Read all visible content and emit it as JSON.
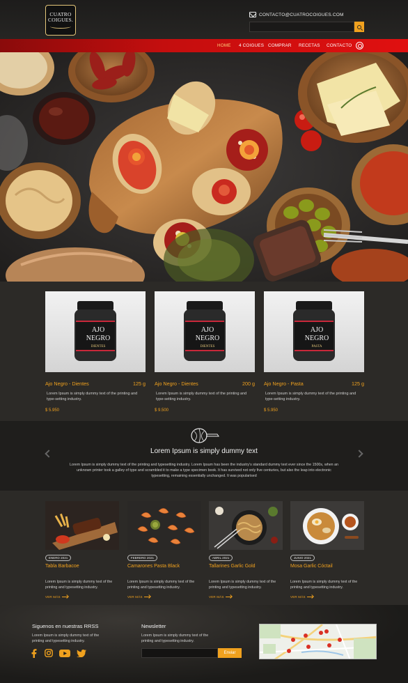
{
  "header": {
    "logo": {
      "line1": "CUATRO",
      "line2": "COIGUES."
    },
    "email": "CONTACTO@CUATROCOIGUES.COM",
    "search": {
      "placeholder": ""
    }
  },
  "nav": {
    "items": [
      {
        "label": "HOME",
        "active": true
      },
      {
        "label": "4 COIGUES"
      },
      {
        "label": "COMPRAR"
      },
      {
        "label": "RECETAS"
      },
      {
        "label": "CONTACTO"
      }
    ]
  },
  "products": [
    {
      "name": "Ajo Negro - Dientes",
      "weight": "125 g",
      "desc": "Lorem Ipsum is simply dummy text of the printing and type-setting industry.",
      "price": "$ 5.950",
      "jar": {
        "l1": "AJO",
        "l2": "NEGRO",
        "l3": "DIENTES"
      }
    },
    {
      "name": "Ajo Negro - Dientes",
      "weight": "200 g",
      "desc": "Lorem Ipsum is simply dummy text of the printing and type-setting industry.",
      "price": "$ 9.500",
      "jar": {
        "l1": "AJO",
        "l2": "NEGRO",
        "l3": "DIENTES"
      }
    },
    {
      "name": "Ajo Negro - Pasta",
      "weight": "125 g",
      "desc": "Lorem Ipsum is simply dummy text of the printing and type-setting industry.",
      "price": "$ 5.950",
      "jar": {
        "l1": "AJO",
        "l2": "NEGRO",
        "l3": "PASTA"
      }
    }
  ],
  "band": {
    "title": "Lorem Ipsum is simply dummy text",
    "text": "Lorem Ipsum is simply dummy text of the printing and typesetting industry. Lorem Ipsum has been the industry's standard dummy text ever since the 1500s, when an unknown printer took a galley of type and scrambled it to make a type specimen book. It has survived not only five centuries, but also the leap into electronic typesetting, remaining essentially unchanged. It was popularised"
  },
  "recipes": [
    {
      "date": "ENERO 2021",
      "title": "Tabla Barbacoe",
      "desc": "Lorem Ipsum is simply dummy text of the printing and typesetting industry.",
      "more": "VER MÁS"
    },
    {
      "date": "FEBRERO 2021",
      "title": "Camarones Pasta Black",
      "desc": "Lorem Ipsum is simply dummy text of the printing and typesetting industry.",
      "more": "VER MÁS"
    },
    {
      "date": "ABRIL 2021",
      "title": "Tallarines Garlic Gold",
      "desc": "Lorem Ipsum is simply dummy text of the printing and typesetting industry.",
      "more": "VER MÁS"
    },
    {
      "date": "JUNIO 2021",
      "title": "Mosa Garlic Cóctail",
      "desc": "Lorem Ipsum is simply dummy text of the printing and typesetting industry.",
      "more": "VER MÁS"
    }
  ],
  "footer": {
    "social_title": "Siguenos en nuestras RRSS",
    "social_text": "Lorem Ipsum is simply dummy text of the printing and typesetting industry.",
    "social_icons": [
      "facebook-icon",
      "instagram-icon",
      "youtube-icon",
      "twitter-icon"
    ],
    "newsletter_title": "Newsletter",
    "newsletter_text": "Lorem Ipsum is simply dummy text of the printing and typesetting industry.",
    "newsletter_placeholder": "",
    "newsletter_button": "Enviar"
  },
  "colors": {
    "accent": "#f0a11e",
    "nav_red": "#d10f0f",
    "background": "#2b2926"
  }
}
